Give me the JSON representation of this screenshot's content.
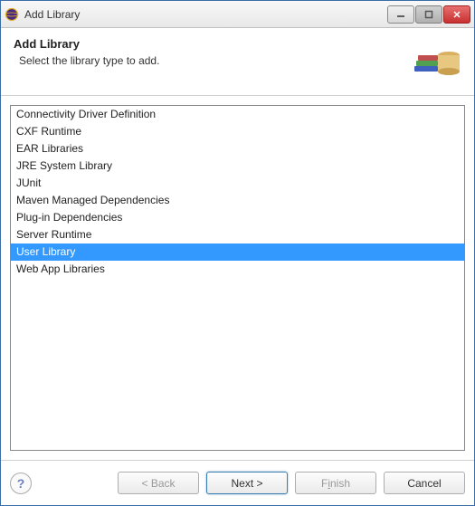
{
  "window": {
    "title": "Add Library"
  },
  "header": {
    "title": "Add Library",
    "subtitle": "Select the library type to add."
  },
  "list": {
    "items": [
      "Connectivity Driver Definition",
      "CXF Runtime",
      "EAR Libraries",
      "JRE System Library",
      "JUnit",
      "Maven Managed Dependencies",
      "Plug-in Dependencies",
      "Server Runtime",
      "User Library",
      "Web App Libraries"
    ],
    "selected_index": 8
  },
  "buttons": {
    "back": "< Back",
    "next": "Next >",
    "finish_pre": "F",
    "finish_u": "i",
    "finish_post": "nish",
    "cancel": "Cancel"
  }
}
